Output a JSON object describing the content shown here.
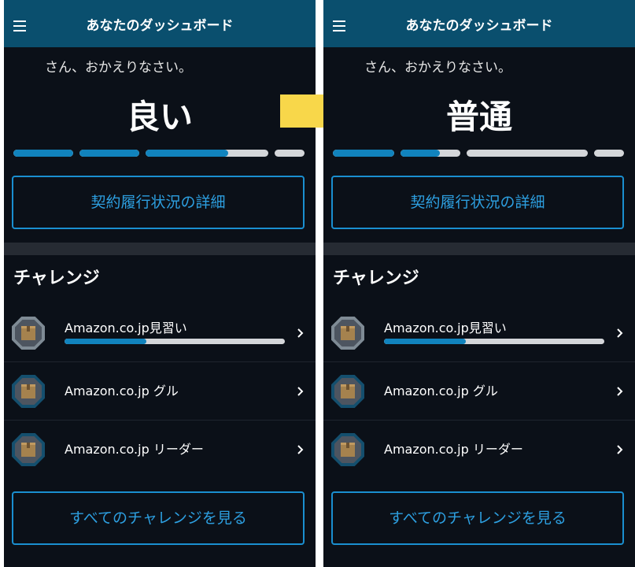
{
  "colors": {
    "background": "#0b1018",
    "appbar": "#0a4f6e",
    "accent_blue": "#1183bd",
    "link_blue": "#2d9fe0",
    "track": "#d4d6d9",
    "arrow": "#f8d74a"
  },
  "transition_arrow_icon": "right-arrow-icon",
  "screens": [
    {
      "appbar": {
        "title": "あなたのダッシュボード",
        "menu_icon": "hamburger-menu-icon"
      },
      "welcome": "さん、おかえりなさい。",
      "status": "良い",
      "segments": [
        1.0,
        1.0,
        0.67,
        0.0
      ],
      "details_button": "契約履行状況の詳細",
      "challenges": {
        "title": "チャレンジ",
        "items": [
          {
            "label": "Amazon.co.jp見習い",
            "progress": 0.37,
            "icon": "box-badge-icon"
          },
          {
            "label": "Amazon.co.jp グル",
            "icon": "box-badge-icon"
          },
          {
            "label": "Amazon.co.jp リーダー",
            "icon": "box-badge-icon"
          }
        ],
        "see_all": "すべてのチャレンジを見る"
      }
    },
    {
      "appbar": {
        "title": "あなたのダッシュボード",
        "menu_icon": "hamburger-menu-icon"
      },
      "welcome": "さん、おかえりなさい。",
      "status": "普通",
      "segments": [
        1.0,
        0.66,
        0.0,
        0.0
      ],
      "details_button": "契約履行状況の詳細",
      "challenges": {
        "title": "チャレンジ",
        "items": [
          {
            "label": "Amazon.co.jp見習い",
            "progress": 0.37,
            "icon": "box-badge-icon"
          },
          {
            "label": "Amazon.co.jp グル",
            "icon": "box-badge-icon"
          },
          {
            "label": "Amazon.co.jp リーダー",
            "icon": "box-badge-icon"
          }
        ],
        "see_all": "すべてのチャレンジを見る"
      }
    }
  ]
}
